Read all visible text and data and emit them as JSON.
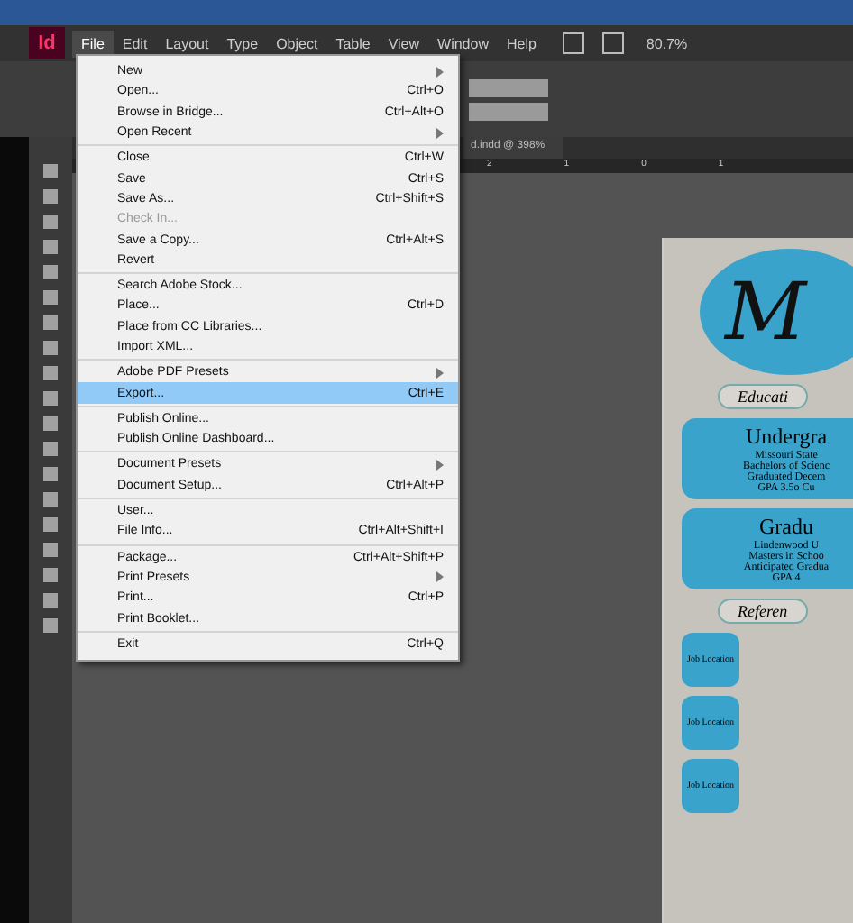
{
  "app": {
    "logo": "Id"
  },
  "menubar": [
    {
      "label": "File",
      "selected": true
    },
    {
      "label": "Edit",
      "selected": false
    },
    {
      "label": "Layout",
      "selected": false
    },
    {
      "label": "Type",
      "selected": false
    },
    {
      "label": "Object",
      "selected": false
    },
    {
      "label": "Table",
      "selected": false
    },
    {
      "label": "View",
      "selected": false
    },
    {
      "label": "Window",
      "selected": false
    },
    {
      "label": "Help",
      "selected": false
    }
  ],
  "zoom": "80.7%",
  "document_tab": {
    "title": "d.indd @ 398%"
  },
  "ruler": [
    "2",
    "1",
    "0",
    "1"
  ],
  "file_menu": [
    [
      {
        "label": "New",
        "submenu": true,
        "disabled": false,
        "selected": false
      },
      {
        "label": "Open...",
        "shortcut": "Ctrl+O",
        "submenu": false,
        "disabled": false,
        "selected": false
      },
      {
        "label": "Browse in Bridge...",
        "shortcut": "Ctrl+Alt+O",
        "submenu": false,
        "disabled": false,
        "selected": false
      },
      {
        "label": "Open Recent",
        "submenu": true,
        "disabled": false,
        "selected": false
      }
    ],
    [
      {
        "label": "Close",
        "shortcut": "Ctrl+W",
        "submenu": false,
        "disabled": false,
        "selected": false
      },
      {
        "label": "Save",
        "shortcut": "Ctrl+S",
        "submenu": false,
        "disabled": false,
        "selected": false
      },
      {
        "label": "Save As...",
        "shortcut": "Ctrl+Shift+S",
        "submenu": false,
        "disabled": false,
        "selected": false
      },
      {
        "label": "Check In...",
        "submenu": false,
        "disabled": true,
        "selected": false
      },
      {
        "label": "Save a Copy...",
        "shortcut": "Ctrl+Alt+S",
        "submenu": false,
        "disabled": false,
        "selected": false
      },
      {
        "label": "Revert",
        "submenu": false,
        "disabled": false,
        "selected": false
      }
    ],
    [
      {
        "label": "Search Adobe Stock...",
        "submenu": false,
        "disabled": false,
        "selected": false
      },
      {
        "label": "Place...",
        "shortcut": "Ctrl+D",
        "submenu": false,
        "disabled": false,
        "selected": false
      },
      {
        "label": "Place from CC Libraries...",
        "submenu": false,
        "disabled": false,
        "selected": false
      },
      {
        "label": "Import XML...",
        "submenu": false,
        "disabled": false,
        "selected": false
      }
    ],
    [
      {
        "label": "Adobe PDF Presets",
        "submenu": true,
        "disabled": false,
        "selected": false
      },
      {
        "label": "Export...",
        "shortcut": "Ctrl+E",
        "submenu": false,
        "disabled": false,
        "selected": true
      }
    ],
    [
      {
        "label": "Publish Online...",
        "submenu": false,
        "disabled": false,
        "selected": false
      },
      {
        "label": "Publish Online Dashboard...",
        "submenu": false,
        "disabled": false,
        "selected": false
      }
    ],
    [
      {
        "label": "Document Presets",
        "submenu": true,
        "disabled": false,
        "selected": false
      },
      {
        "label": "Document Setup...",
        "shortcut": "Ctrl+Alt+P",
        "submenu": false,
        "disabled": false,
        "selected": false
      }
    ],
    [
      {
        "label": "User...",
        "submenu": false,
        "disabled": false,
        "selected": false
      },
      {
        "label": "File Info...",
        "shortcut": "Ctrl+Alt+Shift+I",
        "submenu": false,
        "disabled": false,
        "selected": false
      }
    ],
    [
      {
        "label": "Package...",
        "shortcut": "Ctrl+Alt+Shift+P",
        "submenu": false,
        "disabled": false,
        "selected": false
      },
      {
        "label": "Print Presets",
        "submenu": true,
        "disabled": false,
        "selected": false
      },
      {
        "label": "Print...",
        "shortcut": "Ctrl+P",
        "submenu": false,
        "disabled": false,
        "selected": false
      },
      {
        "label": "Print Booklet...",
        "submenu": false,
        "disabled": false,
        "selected": false
      }
    ],
    [
      {
        "label": "Exit",
        "shortcut": "Ctrl+Q",
        "submenu": false,
        "disabled": false,
        "selected": false
      }
    ]
  ],
  "document": {
    "monogram": "M",
    "sections": [
      {
        "kind": "heading",
        "text": "Educati"
      },
      {
        "kind": "block",
        "title": "Undergra",
        "lines": [
          "Missouri State",
          "Bachelors of Scienc",
          "Graduated Decem",
          "GPA 3.5o Cu"
        ]
      },
      {
        "kind": "block",
        "title": "Gradu",
        "lines": [
          "Lindenwood U",
          "Masters in Schoo",
          "Anticipated Gradua",
          "GPA 4"
        ]
      },
      {
        "kind": "heading",
        "text": "Referen"
      },
      {
        "kind": "job",
        "text": "Job Location"
      },
      {
        "kind": "job",
        "text": "Job Location"
      },
      {
        "kind": "job",
        "text": "Job Location"
      }
    ]
  }
}
